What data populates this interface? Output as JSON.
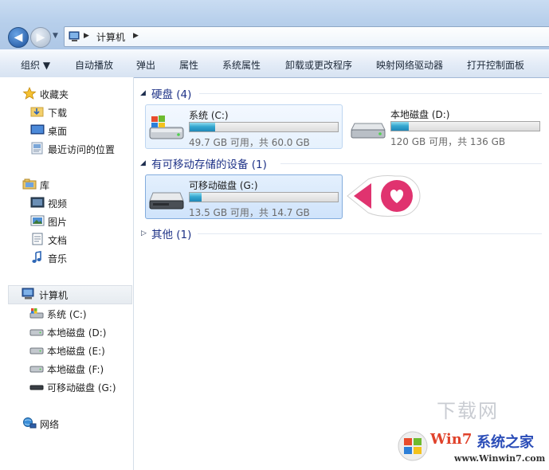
{
  "address": {
    "path": "计算机",
    "back_icon": "back-arrow-icon",
    "forward_icon": "forward-arrow-icon"
  },
  "toolbar": {
    "organize": "组织 ▼",
    "autoplay": "自动播放",
    "eject": "弹出",
    "properties": "属性",
    "system_properties": "系统属性",
    "uninstall": "卸载或更改程序",
    "map_drive": "映射网络驱动器",
    "control_panel": "打开控制面板"
  },
  "nav": {
    "favorites": "收藏夹",
    "downloads": "下载",
    "desktop": "桌面",
    "recent": "最近访问的位置",
    "libraries": "库",
    "videos": "视频",
    "pictures": "图片",
    "documents": "文档",
    "music": "音乐",
    "computer": "计算机",
    "drive_c": "系统 (C:)",
    "drive_d": "本地磁盘 (D:)",
    "drive_e": "本地磁盘 (E:)",
    "drive_f": "本地磁盘 (F:)",
    "drive_g": "可移动磁盘 (G:)",
    "network": "网络"
  },
  "groups": {
    "hdd": "硬盘 (4)",
    "removable": "有可移动存储的设备 (1)",
    "other": "其他 (1)"
  },
  "drives": {
    "c": {
      "name": "系统 (C:)",
      "info": "49.7 GB 可用，共 60.0 GB",
      "used_fraction": 0.17
    },
    "d": {
      "name": "本地磁盘 (D:)",
      "info": "120 GB 可用，共 136 GB",
      "used_fraction": 0.12
    },
    "g": {
      "name": "可移动磁盘 (G:)",
      "info": "13.5 GB 可用，共 14.7 GB",
      "used_fraction": 0.08
    }
  },
  "colors": {
    "accent": "#1e3287",
    "marker": "#e0336f",
    "bar_fill": "#36a8d0"
  },
  "watermark": {
    "site_cn": "下载网",
    "brand_a": "Win7",
    "brand_b": "系统之家",
    "url": "www.Winwin7.com"
  }
}
